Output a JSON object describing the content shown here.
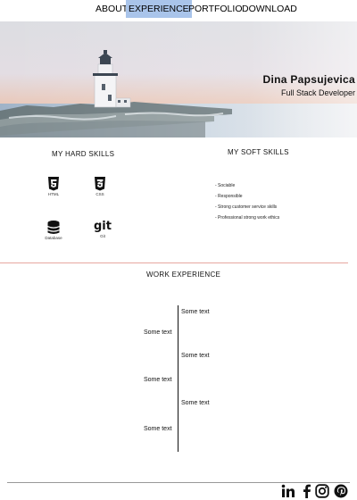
{
  "nav": {
    "items": [
      {
        "label": "ABOUT",
        "active": false
      },
      {
        "label": "EXPERIENCE",
        "active": true
      },
      {
        "label": "PORTFOLIO",
        "active": false
      },
      {
        "label": "DOWNLOAD",
        "active": false
      }
    ],
    "active_color": "#a9c4ea"
  },
  "hero": {
    "name": "Dina Papsujevica",
    "role": "Full Stack Developer"
  },
  "hard_skills": {
    "heading": "MY HARD SKILLS",
    "items": [
      {
        "label": "HTML",
        "icon": "html5-icon"
      },
      {
        "label": "CSS",
        "icon": "css3-icon"
      },
      {
        "label": "Database",
        "icon": "database-icon"
      },
      {
        "label": "Git",
        "icon": "git-icon",
        "logo_text": "git"
      }
    ]
  },
  "soft_skills": {
    "heading": "MY SOFT SKILLS",
    "items": [
      "- Sociable",
      "- Responsible",
      "- Strong customer service skills",
      "- Professional strong work ethics"
    ]
  },
  "work": {
    "heading": "WORK EXPERIENCE",
    "entries": [
      {
        "side": "right",
        "text": "Some text"
      },
      {
        "side": "left",
        "text": "Some text"
      },
      {
        "side": "right",
        "text": "Some text"
      },
      {
        "side": "left",
        "text": "Some text"
      },
      {
        "side": "right",
        "text": "Some text"
      },
      {
        "side": "left",
        "text": "Some text"
      }
    ]
  },
  "social": [
    "linkedin-icon",
    "facebook-icon",
    "instagram-icon",
    "pinterest-icon"
  ],
  "colors": {
    "divider_red": "#e7a7a0",
    "text": "#111111"
  }
}
